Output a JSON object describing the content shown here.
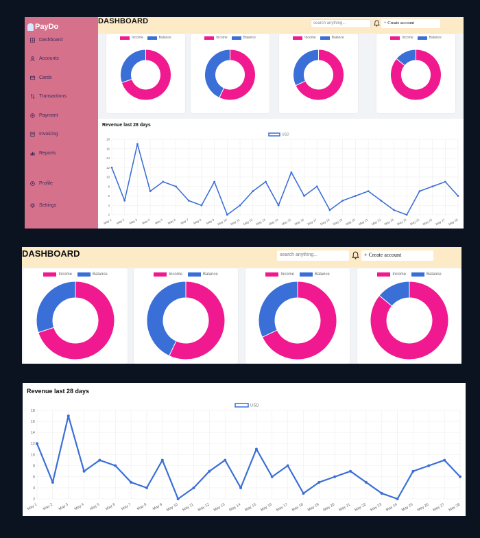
{
  "app": {
    "brand": "PayDo"
  },
  "sidebar": {
    "items": [
      {
        "label": "Dashboard",
        "icon": "grid-icon"
      },
      {
        "label": "Accounts",
        "icon": "user-icon"
      },
      {
        "label": "Cards",
        "icon": "card-icon"
      },
      {
        "label": "Transactions",
        "icon": "transfer-icon"
      },
      {
        "label": "Payment",
        "icon": "payment-icon"
      },
      {
        "label": "Invoicing",
        "icon": "invoice-icon"
      },
      {
        "label": "Reports",
        "icon": "bar-chart-icon"
      },
      {
        "label": "Profile",
        "icon": "profile-icon"
      },
      {
        "label": "Settings",
        "icon": "gear-icon"
      }
    ]
  },
  "header": {
    "title": "DASHBOARD",
    "search_placeholder": "search anything...",
    "create_label": "+ Create account"
  },
  "colors": {
    "income": "#f0198f",
    "balance": "#3a6fd8",
    "sidebar": "#d6718b",
    "topbar": "#fdebc8",
    "line": "#3a6fd8"
  },
  "donuts": {
    "legend": [
      "Income",
      "Balance"
    ],
    "charts": [
      {
        "income": 70,
        "balance": 30
      },
      {
        "income": 57,
        "balance": 43
      },
      {
        "income": 68,
        "balance": 32
      },
      {
        "income": 86,
        "balance": 14
      }
    ]
  },
  "revenue": {
    "title": "Revenue last 28 days",
    "legend": "USD"
  },
  "chart_data": [
    {
      "type": "pie",
      "title": "",
      "categories": [
        "Income",
        "Balance"
      ],
      "values": [
        70,
        30
      ]
    },
    {
      "type": "pie",
      "title": "",
      "categories": [
        "Income",
        "Balance"
      ],
      "values": [
        57,
        43
      ]
    },
    {
      "type": "pie",
      "title": "",
      "categories": [
        "Income",
        "Balance"
      ],
      "values": [
        68,
        32
      ]
    },
    {
      "type": "pie",
      "title": "",
      "categories": [
        "Income",
        "Balance"
      ],
      "values": [
        86,
        14
      ]
    },
    {
      "type": "line",
      "title": "Revenue last 28 days",
      "x": [
        "May 1",
        "May 2",
        "May 3",
        "May 4",
        "May 5",
        "May 6",
        "May 7",
        "May 8",
        "May 9",
        "May 10",
        "May 11",
        "May 12",
        "May 13",
        "May 14",
        "May 15",
        "May 16",
        "May 17",
        "May 18",
        "May 19",
        "May 20",
        "May 21",
        "May 22",
        "May 23",
        "May 24",
        "May 25",
        "May 26",
        "May 27",
        "May 28"
      ],
      "series": [
        {
          "name": "USD",
          "values": [
            12,
            5,
            17,
            7,
            9,
            8,
            5,
            4,
            9,
            2,
            4,
            7,
            9,
            4,
            11,
            6,
            8,
            3,
            5,
            6,
            7,
            5,
            3,
            2,
            7,
            8,
            9,
            6
          ]
        }
      ],
      "ylim": [
        2,
        18
      ],
      "yticks": [
        2,
        4,
        6,
        8,
        10,
        12,
        14,
        16,
        18
      ],
      "grid": true,
      "legend_position": "top-center"
    }
  ]
}
